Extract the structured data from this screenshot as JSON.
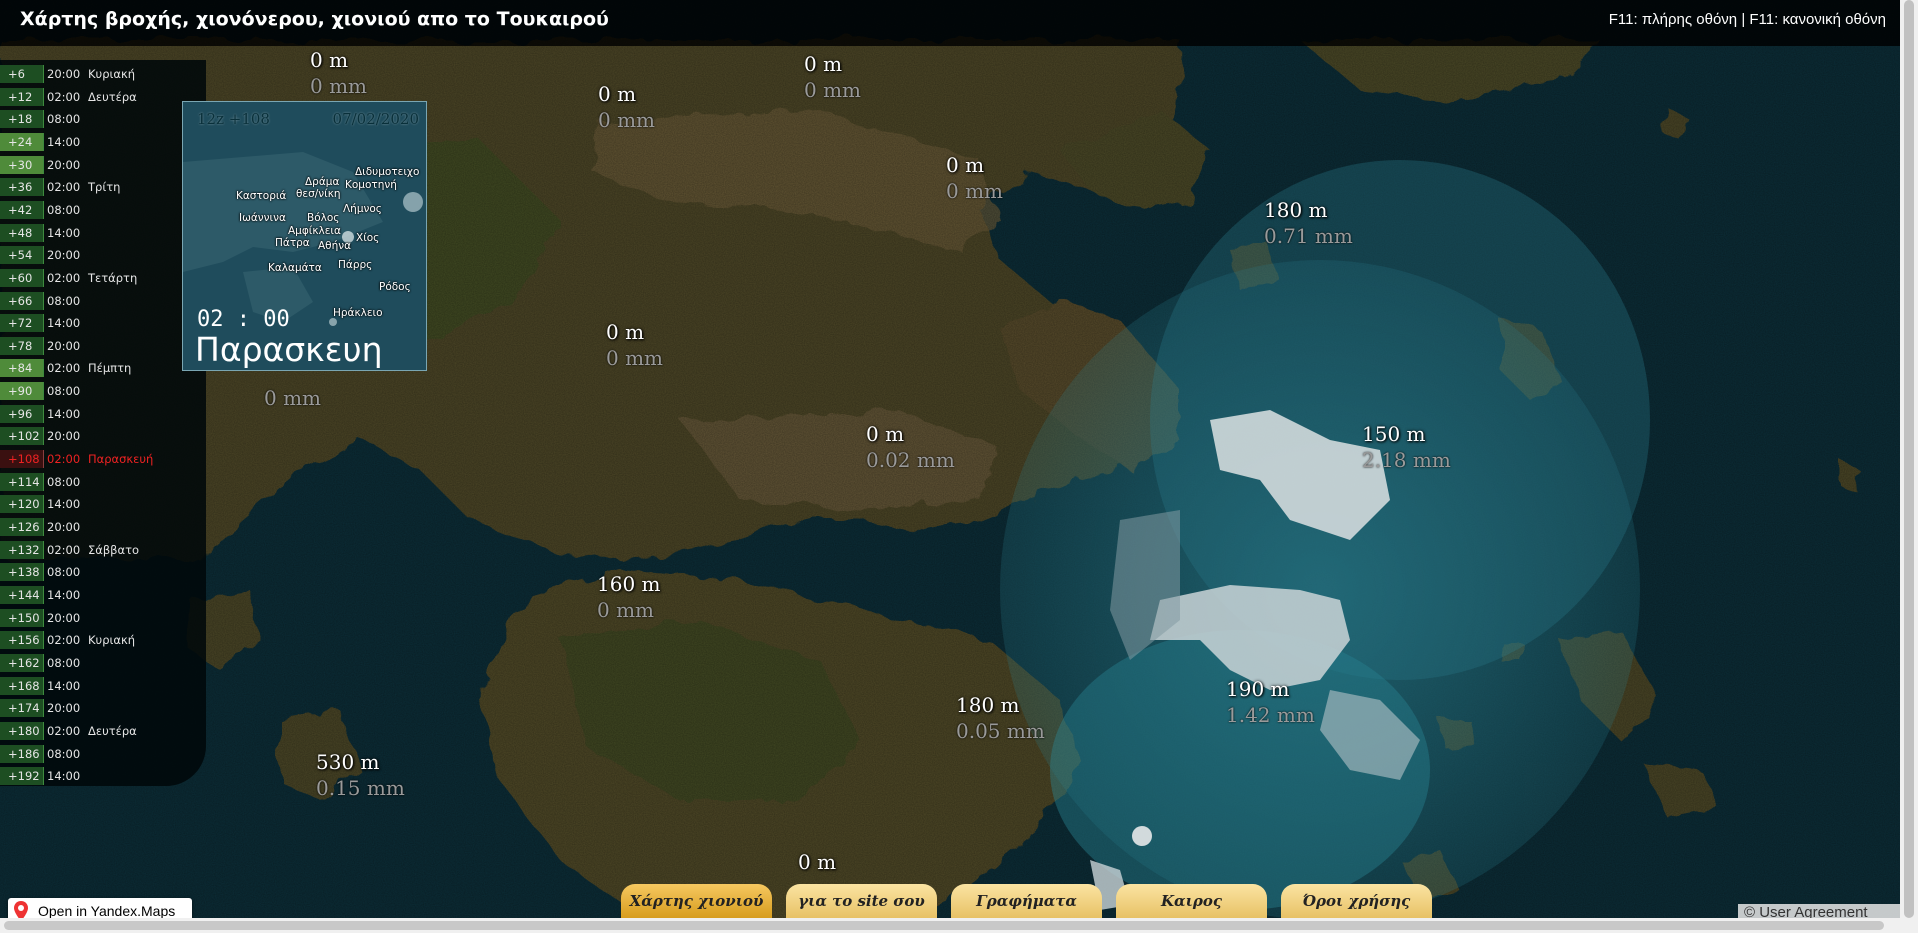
{
  "header": {
    "title": "Χάρτης βροχής, χιονόνερου, χιονιού απο το Τουκαιρού",
    "shortcuts": "F11: πλήρης οθόνη | F11: κανονική οθόνη"
  },
  "timeline": [
    {
      "offset": "+6",
      "time": "20:00",
      "day": "Κυριακή"
    },
    {
      "offset": "+12",
      "time": "02:00",
      "day": "Δευτέρα"
    },
    {
      "offset": "+18",
      "time": "08:00",
      "day": ""
    },
    {
      "offset": "+24",
      "time": "14:00",
      "day": ""
    },
    {
      "offset": "+30",
      "time": "20:00",
      "day": ""
    },
    {
      "offset": "+36",
      "time": "02:00",
      "day": "Τρίτη"
    },
    {
      "offset": "+42",
      "time": "08:00",
      "day": ""
    },
    {
      "offset": "+48",
      "time": "14:00",
      "day": ""
    },
    {
      "offset": "+54",
      "time": "20:00",
      "day": ""
    },
    {
      "offset": "+60",
      "time": "02:00",
      "day": "Τετάρτη"
    },
    {
      "offset": "+66",
      "time": "08:00",
      "day": ""
    },
    {
      "offset": "+72",
      "time": "14:00",
      "day": ""
    },
    {
      "offset": "+78",
      "time": "20:00",
      "day": ""
    },
    {
      "offset": "+84",
      "time": "02:00",
      "day": "Πέμπτη"
    },
    {
      "offset": "+90",
      "time": "08:00",
      "day": ""
    },
    {
      "offset": "+96",
      "time": "14:00",
      "day": ""
    },
    {
      "offset": "+102",
      "time": "20:00",
      "day": ""
    },
    {
      "offset": "+108",
      "time": "02:00",
      "day": "Παρασκευή"
    },
    {
      "offset": "+114",
      "time": "08:00",
      "day": ""
    },
    {
      "offset": "+120",
      "time": "14:00",
      "day": ""
    },
    {
      "offset": "+126",
      "time": "20:00",
      "day": ""
    },
    {
      "offset": "+132",
      "time": "02:00",
      "day": "Σάββατο"
    },
    {
      "offset": "+138",
      "time": "08:00",
      "day": ""
    },
    {
      "offset": "+144",
      "time": "14:00",
      "day": ""
    },
    {
      "offset": "+150",
      "time": "20:00",
      "day": ""
    },
    {
      "offset": "+156",
      "time": "02:00",
      "day": "Κυριακή"
    },
    {
      "offset": "+162",
      "time": "08:00",
      "day": ""
    },
    {
      "offset": "+168",
      "time": "14:00",
      "day": ""
    },
    {
      "offset": "+174",
      "time": "20:00",
      "day": ""
    },
    {
      "offset": "+180",
      "time": "02:00",
      "day": "Δευτέρα"
    },
    {
      "offset": "+186",
      "time": "08:00",
      "day": ""
    },
    {
      "offset": "+192",
      "time": "14:00",
      "day": ""
    }
  ],
  "timeline_active_index": 17,
  "inset": {
    "run": "12z +108",
    "date": "07/02/2020",
    "time": "02 : 00",
    "day": "Παρασκευη",
    "cities": [
      "Διδυμοτειχο",
      "Δράμα",
      "Κομοτηνή",
      "Καστοριά",
      "θεσ/νίκη",
      "Λήμνος",
      "Ιωάννινα",
      "Βόλος",
      "Αμφίκλεια",
      "Χίος",
      "Πάτρα",
      "Αθήνα",
      "Πάρρς",
      "Καλαμάτα",
      "Ρόδος",
      "Ηράκλειο"
    ]
  },
  "map_labels": [
    {
      "alt": "0 m",
      "mm": "0 mm"
    },
    {
      "alt": "0 m",
      "mm": "0 mm"
    },
    {
      "alt": "0 m",
      "mm": "0 mm"
    },
    {
      "alt": "0 m",
      "mm": "0 mm"
    },
    {
      "alt": "180 m",
      "mm": "0.71 mm"
    },
    {
      "alt": "0 m",
      "mm": "0 mm"
    },
    {
      "alt": "",
      "mm": "0 mm"
    },
    {
      "alt": "0 m",
      "mm": "0.02 mm"
    },
    {
      "alt": "150 m",
      "mm": "2.18 mm"
    },
    {
      "alt": "160 m",
      "mm": "0 mm"
    },
    {
      "alt": "190 m",
      "mm": "1.42 mm"
    },
    {
      "alt": "180 m",
      "mm": "0.05 mm"
    },
    {
      "alt": "530 m",
      "mm": "0.15 mm"
    },
    {
      "alt": "0 m",
      "mm": ""
    }
  ],
  "nav": [
    {
      "label": "Χάρτης χιονιού",
      "active": true
    },
    {
      "label": "για το site σου",
      "active": false
    },
    {
      "label": "Γραφήματα",
      "active": false
    },
    {
      "label": "Καιρος",
      "active": false
    },
    {
      "label": "Όροι χρήσης",
      "active": false
    }
  ],
  "yandex": {
    "label": "Open in Yandex.Maps"
  },
  "agreement": "© User Agreement",
  "icons": {
    "yandex_pin": "map-pin-icon"
  }
}
